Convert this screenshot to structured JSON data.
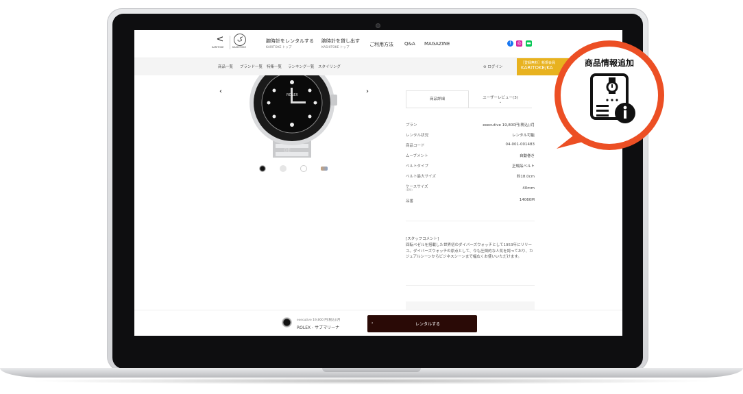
{
  "header": {
    "logo_left_sub": "KARITOKE",
    "logo_right_sub": "KASHITOKE",
    "nav": [
      {
        "main": "腕時計をレンタルする",
        "sub": "KARITOKE トップ"
      },
      {
        "main": "腕時計を貸し出す",
        "sub": "KASHITOKE トップ"
      },
      {
        "main": "ご利用方法"
      },
      {
        "main": "Q&A"
      },
      {
        "main": "MAGAZINE"
      }
    ],
    "social": [
      {
        "icon": "facebook-icon",
        "color": "#1877f2"
      },
      {
        "icon": "instagram-icon",
        "color": "#d6249f"
      },
      {
        "icon": "line-icon",
        "color": "#06c755"
      }
    ]
  },
  "subnav": {
    "items": [
      "商品一覧",
      "ブランド一覧",
      "特集一覧",
      "ランキング一覧",
      "スタイリング"
    ],
    "login": "ログイン",
    "signup": [
      "［登録無料］新規会員",
      "KARITOKE/KA"
    ]
  },
  "product": {
    "arrow_left": "‹",
    "arrow_right": "›",
    "tabs": {
      "details": "商品詳細",
      "reviews": "ユーザーレビュー(3)"
    },
    "specs": [
      {
        "label": "プラン",
        "value": "executive 19,800円(税込)/月"
      },
      {
        "label": "レンタル状況",
        "value": "レンタル可能"
      },
      {
        "label": "商品コード",
        "value": "04-001-001483"
      },
      {
        "label": "ムーブメント",
        "value": "自動巻き"
      },
      {
        "label": "ベルトタイプ",
        "value": "正規品ベルト"
      },
      {
        "label": "ベルト最大サイズ",
        "value": "約18.0cm"
      },
      {
        "label": "ケースサイズ",
        "sublabel": "(直径)",
        "value": "40mm"
      },
      {
        "label": "品番",
        "value": "14060M"
      }
    ],
    "comment_title": "[スタッフコメント]",
    "comment": "回転ベゼルを搭載した世界初のダイバーズウォッチとして1953年にリリース。ダイバーズウォッチの原点として、今も圧倒的な人気を誇っており、カジュアルシーンからビジネスシーンまで幅広くお使いいただけます。"
  },
  "bottom_bar": {
    "plan": "executive 19,800 円(税込)/月",
    "name": "ROLEX - サブマリーナ",
    "rent_label": "レンタルする",
    "chevron": "›"
  },
  "callout": {
    "label": "商品情報追加",
    "accent": "#ec4f24"
  }
}
